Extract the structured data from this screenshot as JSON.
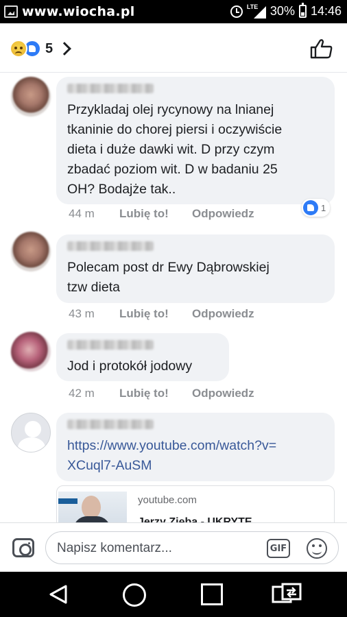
{
  "status_bar": {
    "watermark": "www.wiocha.pl",
    "network": "LTE",
    "battery": "30%",
    "time": "14:46"
  },
  "header": {
    "reaction_count": "5",
    "reaction_icons": [
      "sad-reaction-icon",
      "like-reaction-icon"
    ]
  },
  "comments": [
    {
      "author_blurred": true,
      "text": "Przykladaj olej rycynowy na lnianej\ntkaninie do chorej piersi i oczywiście\ndieta i duże dawki wit. D przy czym\nzbadać poziom wit. D w badaniu 25\nOH? Bodajże tak..",
      "time": "44 m",
      "like_label": "Lubię to!",
      "reply_label": "Odpowiedz",
      "likes": "1"
    },
    {
      "author_blurred": true,
      "text": "Polecam post dr Ewy Dąbrowskiej\ntzw dieta",
      "time": "43 m",
      "like_label": "Lubię to!",
      "reply_label": "Odpowiedz"
    },
    {
      "author_blurred": true,
      "text": "Jod i protokół jodowy",
      "time": "42 m",
      "like_label": "Lubię to!",
      "reply_label": "Odpowiedz"
    },
    {
      "author_blurred": true,
      "link": "https://www.youtube.com/watch?v=\nXCuql7-AuSM",
      "preview": {
        "domain": "youtube.com",
        "title": "Jerzy Zięba - UKRYTE"
      }
    }
  ],
  "composer": {
    "placeholder": "Napisz komentarz...",
    "gif_label": "GIF"
  },
  "colors": {
    "like_blue": "#2e7bf6",
    "link": "#385898",
    "bubble": "#f0f2f5",
    "meta_gray": "#8a8d91"
  }
}
